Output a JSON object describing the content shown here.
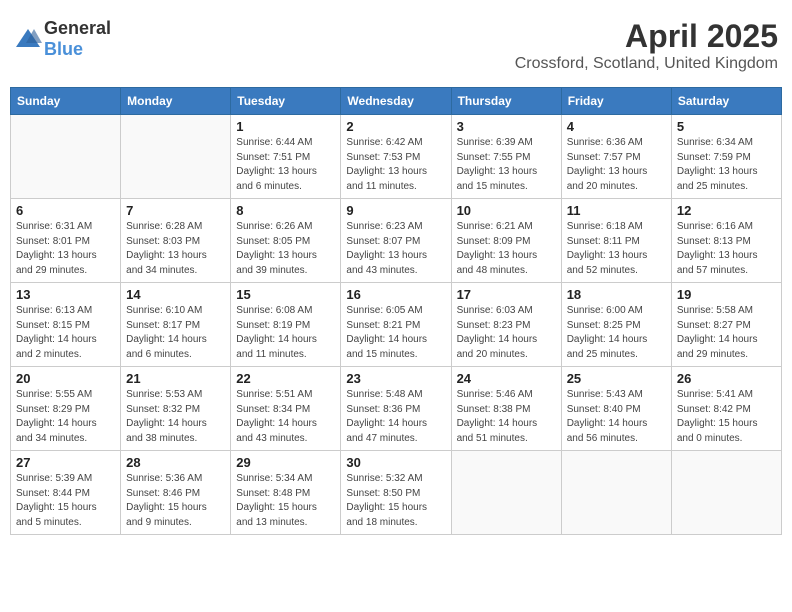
{
  "logo": {
    "general": "General",
    "blue": "Blue"
  },
  "title": "April 2025",
  "location": "Crossford, Scotland, United Kingdom",
  "weekdays": [
    "Sunday",
    "Monday",
    "Tuesday",
    "Wednesday",
    "Thursday",
    "Friday",
    "Saturday"
  ],
  "weeks": [
    [
      {
        "day": null
      },
      {
        "day": null
      },
      {
        "day": "1",
        "sunrise": "Sunrise: 6:44 AM",
        "sunset": "Sunset: 7:51 PM",
        "daylight": "Daylight: 13 hours and 6 minutes."
      },
      {
        "day": "2",
        "sunrise": "Sunrise: 6:42 AM",
        "sunset": "Sunset: 7:53 PM",
        "daylight": "Daylight: 13 hours and 11 minutes."
      },
      {
        "day": "3",
        "sunrise": "Sunrise: 6:39 AM",
        "sunset": "Sunset: 7:55 PM",
        "daylight": "Daylight: 13 hours and 15 minutes."
      },
      {
        "day": "4",
        "sunrise": "Sunrise: 6:36 AM",
        "sunset": "Sunset: 7:57 PM",
        "daylight": "Daylight: 13 hours and 20 minutes."
      },
      {
        "day": "5",
        "sunrise": "Sunrise: 6:34 AM",
        "sunset": "Sunset: 7:59 PM",
        "daylight": "Daylight: 13 hours and 25 minutes."
      }
    ],
    [
      {
        "day": "6",
        "sunrise": "Sunrise: 6:31 AM",
        "sunset": "Sunset: 8:01 PM",
        "daylight": "Daylight: 13 hours and 29 minutes."
      },
      {
        "day": "7",
        "sunrise": "Sunrise: 6:28 AM",
        "sunset": "Sunset: 8:03 PM",
        "daylight": "Daylight: 13 hours and 34 minutes."
      },
      {
        "day": "8",
        "sunrise": "Sunrise: 6:26 AM",
        "sunset": "Sunset: 8:05 PM",
        "daylight": "Daylight: 13 hours and 39 minutes."
      },
      {
        "day": "9",
        "sunrise": "Sunrise: 6:23 AM",
        "sunset": "Sunset: 8:07 PM",
        "daylight": "Daylight: 13 hours and 43 minutes."
      },
      {
        "day": "10",
        "sunrise": "Sunrise: 6:21 AM",
        "sunset": "Sunset: 8:09 PM",
        "daylight": "Daylight: 13 hours and 48 minutes."
      },
      {
        "day": "11",
        "sunrise": "Sunrise: 6:18 AM",
        "sunset": "Sunset: 8:11 PM",
        "daylight": "Daylight: 13 hours and 52 minutes."
      },
      {
        "day": "12",
        "sunrise": "Sunrise: 6:16 AM",
        "sunset": "Sunset: 8:13 PM",
        "daylight": "Daylight: 13 hours and 57 minutes."
      }
    ],
    [
      {
        "day": "13",
        "sunrise": "Sunrise: 6:13 AM",
        "sunset": "Sunset: 8:15 PM",
        "daylight": "Daylight: 14 hours and 2 minutes."
      },
      {
        "day": "14",
        "sunrise": "Sunrise: 6:10 AM",
        "sunset": "Sunset: 8:17 PM",
        "daylight": "Daylight: 14 hours and 6 minutes."
      },
      {
        "day": "15",
        "sunrise": "Sunrise: 6:08 AM",
        "sunset": "Sunset: 8:19 PM",
        "daylight": "Daylight: 14 hours and 11 minutes."
      },
      {
        "day": "16",
        "sunrise": "Sunrise: 6:05 AM",
        "sunset": "Sunset: 8:21 PM",
        "daylight": "Daylight: 14 hours and 15 minutes."
      },
      {
        "day": "17",
        "sunrise": "Sunrise: 6:03 AM",
        "sunset": "Sunset: 8:23 PM",
        "daylight": "Daylight: 14 hours and 20 minutes."
      },
      {
        "day": "18",
        "sunrise": "Sunrise: 6:00 AM",
        "sunset": "Sunset: 8:25 PM",
        "daylight": "Daylight: 14 hours and 25 minutes."
      },
      {
        "day": "19",
        "sunrise": "Sunrise: 5:58 AM",
        "sunset": "Sunset: 8:27 PM",
        "daylight": "Daylight: 14 hours and 29 minutes."
      }
    ],
    [
      {
        "day": "20",
        "sunrise": "Sunrise: 5:55 AM",
        "sunset": "Sunset: 8:29 PM",
        "daylight": "Daylight: 14 hours and 34 minutes."
      },
      {
        "day": "21",
        "sunrise": "Sunrise: 5:53 AM",
        "sunset": "Sunset: 8:32 PM",
        "daylight": "Daylight: 14 hours and 38 minutes."
      },
      {
        "day": "22",
        "sunrise": "Sunrise: 5:51 AM",
        "sunset": "Sunset: 8:34 PM",
        "daylight": "Daylight: 14 hours and 43 minutes."
      },
      {
        "day": "23",
        "sunrise": "Sunrise: 5:48 AM",
        "sunset": "Sunset: 8:36 PM",
        "daylight": "Daylight: 14 hours and 47 minutes."
      },
      {
        "day": "24",
        "sunrise": "Sunrise: 5:46 AM",
        "sunset": "Sunset: 8:38 PM",
        "daylight": "Daylight: 14 hours and 51 minutes."
      },
      {
        "day": "25",
        "sunrise": "Sunrise: 5:43 AM",
        "sunset": "Sunset: 8:40 PM",
        "daylight": "Daylight: 14 hours and 56 minutes."
      },
      {
        "day": "26",
        "sunrise": "Sunrise: 5:41 AM",
        "sunset": "Sunset: 8:42 PM",
        "daylight": "Daylight: 15 hours and 0 minutes."
      }
    ],
    [
      {
        "day": "27",
        "sunrise": "Sunrise: 5:39 AM",
        "sunset": "Sunset: 8:44 PM",
        "daylight": "Daylight: 15 hours and 5 minutes."
      },
      {
        "day": "28",
        "sunrise": "Sunrise: 5:36 AM",
        "sunset": "Sunset: 8:46 PM",
        "daylight": "Daylight: 15 hours and 9 minutes."
      },
      {
        "day": "29",
        "sunrise": "Sunrise: 5:34 AM",
        "sunset": "Sunset: 8:48 PM",
        "daylight": "Daylight: 15 hours and 13 minutes."
      },
      {
        "day": "30",
        "sunrise": "Sunrise: 5:32 AM",
        "sunset": "Sunset: 8:50 PM",
        "daylight": "Daylight: 15 hours and 18 minutes."
      },
      {
        "day": null
      },
      {
        "day": null
      },
      {
        "day": null
      }
    ]
  ]
}
